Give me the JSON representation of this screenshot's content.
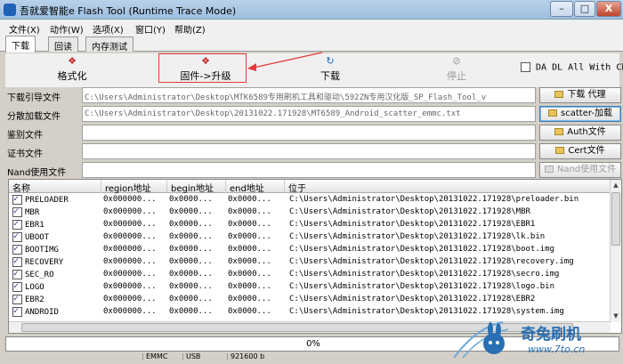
{
  "window": {
    "title": "吾就爱智能e Flash Tool (Runtime Trace Mode)",
    "controls": [
      "–",
      "□",
      "X"
    ]
  },
  "menu": [
    "文件(X)",
    "动作(W)",
    "选项(X)",
    "窗口(Y)",
    "帮助(Z)"
  ],
  "tabs": [
    "下载",
    "回读",
    "内存测试"
  ],
  "toolbar": {
    "format_label": "格式化",
    "firmware_upgrade_label": "固件->升级",
    "download_label": "下载",
    "stop_label": "停止",
    "da_dl_all_label": "DA DL All With Ch"
  },
  "form": {
    "rows": [
      {
        "label": "下载引导文件",
        "value": "C:\\Users\\Administrator\\Desktop\\MTK6589专用刷机工具和驱动\\592ZN专用汉化版_SP_Flash_Tool_v",
        "button": "下载 代理"
      },
      {
        "label": "分散加载文件",
        "value": "C:\\Users\\Administrator\\Desktop\\20131022.171928\\MT6589_Android_scatter_emmc.txt",
        "button": "scatter-加载"
      },
      {
        "label": "鉴别文件",
        "value": "",
        "button": "Auth文件"
      },
      {
        "label": "证书文件",
        "value": "",
        "button": "Cert文件"
      },
      {
        "label": "Nand使用文件",
        "value": "",
        "button": "Nand使用文件"
      }
    ]
  },
  "list": {
    "headers": [
      "名称",
      "region地址",
      "begin地址",
      "end地址",
      "位于"
    ],
    "rows": [
      {
        "name": "PRELOADER",
        "region": "0x000000...",
        "begin": "0x0000...",
        "end": "0x0000...",
        "path": "C:\\Users\\Administrator\\Desktop\\20131022.171928\\preloader.bin",
        "checked": true
      },
      {
        "name": "MBR",
        "region": "0x000000...",
        "begin": "0x0000...",
        "end": "0x0000...",
        "path": "C:\\Users\\Administrator\\Desktop\\20131022.171928\\MBR",
        "checked": true
      },
      {
        "name": "EBR1",
        "region": "0x000000...",
        "begin": "0x0000...",
        "end": "0x0000...",
        "path": "C:\\Users\\Administrator\\Desktop\\20131022.171928\\EBR1",
        "checked": true
      },
      {
        "name": "UBOOT",
        "region": "0x000000...",
        "begin": "0x0000...",
        "end": "0x0000...",
        "path": "C:\\Users\\Administrator\\Desktop\\20131022.171928\\lk.bin",
        "checked": true
      },
      {
        "name": "BOOTIMG",
        "region": "0x000000...",
        "begin": "0x0000...",
        "end": "0x0000...",
        "path": "C:\\Users\\Administrator\\Desktop\\20131022.171928\\boot.img",
        "checked": true
      },
      {
        "name": "RECOVERY",
        "region": "0x000000...",
        "begin": "0x0000...",
        "end": "0x0000...",
        "path": "C:\\Users\\Administrator\\Desktop\\20131022.171928\\recovery.img",
        "checked": true
      },
      {
        "name": "SEC_RO",
        "region": "0x000000...",
        "begin": "0x0000...",
        "end": "0x0000...",
        "path": "C:\\Users\\Administrator\\Desktop\\20131022.171928\\secro.img",
        "checked": true
      },
      {
        "name": "LOGO",
        "region": "0x000000...",
        "begin": "0x0000...",
        "end": "0x0000...",
        "path": "C:\\Users\\Administrator\\Desktop\\20131022.171928\\logo.bin",
        "checked": true
      },
      {
        "name": "EBR2",
        "region": "0x000000...",
        "begin": "0x0000...",
        "end": "0x0000...",
        "path": "C:\\Users\\Administrator\\Desktop\\20131022.171928\\EBR2",
        "checked": true
      },
      {
        "name": "ANDROID",
        "region": "0x000000...",
        "begin": "0x0000...",
        "end": "0x0000...",
        "path": "C:\\Users\\Administrator\\Desktop\\20131022.171928\\system.img",
        "checked": true
      }
    ]
  },
  "progress": {
    "text": "0%"
  },
  "status": {
    "storage": "EMMC",
    "port": "USB",
    "baud": "921600 b"
  },
  "watermark": {
    "brand": "奇兔刷机",
    "site": "www.7to.cn"
  },
  "colors": {
    "highlight": "#e53a3a",
    "accent": "#2a6fb3"
  }
}
